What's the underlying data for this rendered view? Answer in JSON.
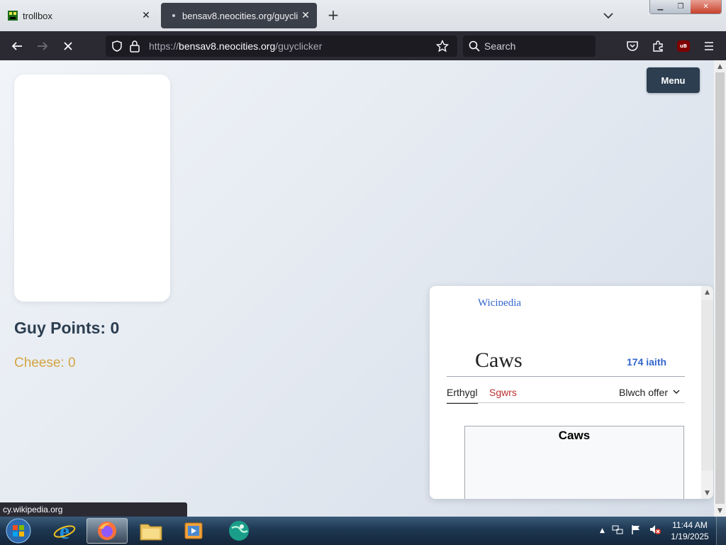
{
  "browser": {
    "tabs": [
      {
        "title": "trollbox",
        "icon": "trollbox-favicon-icon",
        "active": false
      },
      {
        "title": "bensav8.neocities.org/guyclicker",
        "icon": "dot-favicon-icon",
        "active": true
      }
    ],
    "url": {
      "prefix": "https://",
      "host": "bensav8.neocities.org",
      "path": "/guyclicker"
    },
    "search_placeholder": "Search",
    "extension_badge": "uB",
    "status_text": "cy.wikipedia.org"
  },
  "page": {
    "points_label": "Guy Points: 0",
    "cheese_label": "Cheese: 0",
    "menu_label": "Menu",
    "colors": {
      "points": "#2c3e50",
      "cheese": "#d4a544",
      "menu_bg": "#2c3e50"
    }
  },
  "popup": {
    "logo_text": "Wicipedia",
    "title": "Caws",
    "languages": "174 iaith",
    "tab_article": "Erthygl",
    "tab_talk": "Sgwrs",
    "tools": "Blwch offer",
    "infobox_title": "Caws"
  },
  "taskbar": {
    "time": "11:44 AM",
    "date": "1/19/2025",
    "apps": [
      "internet-explorer-icon",
      "firefox-icon",
      "file-explorer-icon",
      "media-player-icon",
      "globe-app-icon"
    ]
  }
}
